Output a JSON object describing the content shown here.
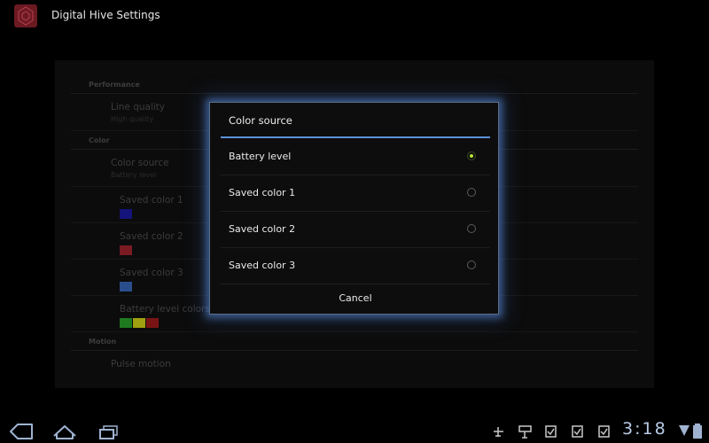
{
  "app": {
    "title": "Digital Hive Settings"
  },
  "settings": {
    "categories": {
      "performance": "Performance",
      "color": "Color",
      "motion": "Motion"
    },
    "line_quality": {
      "title": "Line quality",
      "summary": "High quality"
    },
    "color_source": {
      "title": "Color source",
      "summary": "Battery level"
    },
    "saved_color_1": {
      "title": "Saved color 1",
      "swatch": "#14147a"
    },
    "saved_color_2": {
      "title": "Saved color 2",
      "swatch": "#7a1a22"
    },
    "saved_color_3": {
      "title": "Saved color 3",
      "swatch": "#2a4e8c"
    },
    "battery_colors": {
      "title": "Battery level colors",
      "swatches": [
        "#1f7a1f",
        "#a0a010",
        "#7a1414"
      ]
    },
    "pulse_motion": {
      "title": "Pulse motion"
    }
  },
  "dialog": {
    "title": "Color source",
    "options": [
      {
        "label": "Battery level",
        "selected": true
      },
      {
        "label": "Saved color 1",
        "selected": false
      },
      {
        "label": "Saved color 2",
        "selected": false
      },
      {
        "label": "Saved color 3",
        "selected": false
      }
    ],
    "cancel_label": "Cancel"
  },
  "system_bar": {
    "time": "3:18",
    "icons": [
      "back-icon",
      "home-icon",
      "recent-apps-icon",
      "usb-debugging-icon",
      "usb-connection-icon",
      "download-complete-icon",
      "download-complete-icon",
      "download-complete-icon",
      "signal-icon",
      "battery-icon"
    ]
  },
  "colors": {
    "accent": "#5c8fd6",
    "selected_radio": "#b6e33a",
    "clock": "#b7cbe6"
  }
}
